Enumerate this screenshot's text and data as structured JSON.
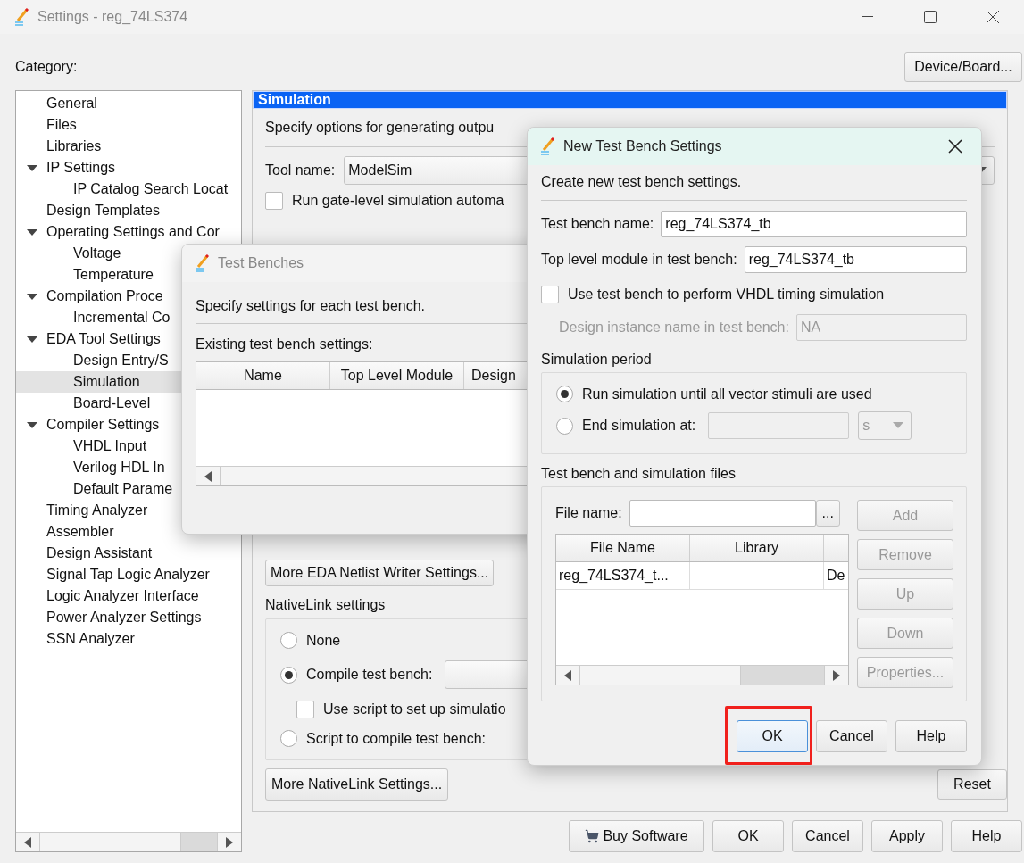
{
  "window": {
    "title": "Settings - reg_74LS374"
  },
  "category_label": "Category:",
  "device_button": "Device/Board...",
  "category_tree": [
    {
      "label": "General",
      "selected": false
    },
    {
      "label": "Files",
      "selected": false
    },
    {
      "label": "Libraries",
      "selected": false
    },
    {
      "label": "IP Settings",
      "selected": false,
      "expanded": true,
      "children": [
        {
          "label": "IP Catalog Search Locat",
          "selected": false
        }
      ]
    },
    {
      "label": "Design Templates",
      "selected": false
    },
    {
      "label": "Operating Settings and Cor",
      "selected": false,
      "expanded": true,
      "children": [
        {
          "label": "Voltage",
          "selected": false
        },
        {
          "label": "Temperature",
          "selected": false
        }
      ]
    },
    {
      "label": "Compilation Proce",
      "selected": false,
      "expanded": true,
      "children": [
        {
          "label": "Incremental Co",
          "selected": false
        }
      ]
    },
    {
      "label": "EDA Tool Settings",
      "selected": false,
      "expanded": true,
      "children": [
        {
          "label": "Design Entry/S",
          "selected": false
        },
        {
          "label": "Simulation",
          "selected": true
        },
        {
          "label": "Board-Level",
          "selected": false
        }
      ]
    },
    {
      "label": "Compiler Settings",
      "selected": false,
      "expanded": true,
      "children": [
        {
          "label": "VHDL Input",
          "selected": false
        },
        {
          "label": "Verilog HDL In",
          "selected": false
        },
        {
          "label": "Default Parame",
          "selected": false
        }
      ]
    },
    {
      "label": "Timing Analyzer",
      "selected": false
    },
    {
      "label": "Assembler",
      "selected": false
    },
    {
      "label": "Design Assistant",
      "selected": false
    },
    {
      "label": "Signal Tap Logic Analyzer",
      "selected": false
    },
    {
      "label": "Logic Analyzer Interface",
      "selected": false
    },
    {
      "label": "Power Analyzer Settings",
      "selected": false
    },
    {
      "label": "SSN Analyzer",
      "selected": false
    }
  ],
  "simulation_panel": {
    "title": "Simulation",
    "description": "Specify options for generating outpu",
    "tool_name": {
      "label": "Tool name:",
      "value": "ModelSim"
    },
    "gate_level": {
      "label": "Run gate-level simulation automa",
      "checked": false
    },
    "netlist_button": "More EDA Netlist Writer Settings...",
    "nativelink": {
      "title": "NativeLink settings",
      "options": [
        {
          "label": "None",
          "selected": false
        },
        {
          "label": "Compile test bench:",
          "selected": true
        },
        {
          "label": "Script to compile test bench:",
          "selected": false
        }
      ],
      "use_script": {
        "label": "Use script to set up simulatio",
        "checked": false
      }
    },
    "nativelink_button": "More NativeLink Settings...",
    "reset_button": "Reset"
  },
  "footer_buttons": [
    {
      "label": "Buy Software",
      "kind": "purchase"
    },
    {
      "label": "OK",
      "kind": "plain"
    },
    {
      "label": "Cancel",
      "kind": "plain"
    },
    {
      "label": "Apply",
      "kind": "plain"
    },
    {
      "label": "Help",
      "kind": "plain"
    }
  ],
  "test_benches_dialog": {
    "title": "Test Benches",
    "description": "Specify settings for each test bench.",
    "list_label": "Existing test bench settings:",
    "columns": [
      "Name",
      "Top Level Module",
      "Design"
    ]
  },
  "new_test_bench_dialog": {
    "title": "New Test Bench Settings",
    "description": "Create new test bench settings.",
    "test_bench_name": {
      "label": "Test bench name:",
      "value": "reg_74LS374_tb"
    },
    "top_level_module": {
      "label": "Top level module in test bench:",
      "value": "reg_74LS374_tb"
    },
    "vhdl_timing": {
      "label": "Use test bench to perform VHDL timing simulation",
      "checked": false
    },
    "design_instance": {
      "label": "Design instance name in test bench:",
      "value": "NA",
      "disabled": true
    },
    "simulation_period": {
      "title": "Simulation period",
      "options": [
        {
          "label": "Run simulation until all vector stimuli are used",
          "selected": true
        },
        {
          "label": "End simulation at:",
          "selected": false
        }
      ],
      "unit": "s"
    },
    "files": {
      "title": "Test bench and simulation files",
      "file_name_label": "File name:",
      "browse_button": "...",
      "columns": [
        "File Name",
        "Library"
      ],
      "rows": [
        {
          "file_name": "reg_74LS374_t...",
          "column_3": "De"
        }
      ],
      "side_buttons": [
        {
          "label": "Add",
          "disabled": true
        },
        {
          "label": "Remove",
          "disabled": true
        },
        {
          "label": "Up",
          "disabled": true
        },
        {
          "label": "Down",
          "disabled": true
        },
        {
          "label": "Properties...",
          "disabled": true
        }
      ]
    },
    "buttons": [
      {
        "label": "OK",
        "focused": true,
        "highlighted": true
      },
      {
        "label": "Cancel",
        "focused": false,
        "highlighted": false
      },
      {
        "label": "Help",
        "focused": false,
        "highlighted": false
      }
    ]
  }
}
